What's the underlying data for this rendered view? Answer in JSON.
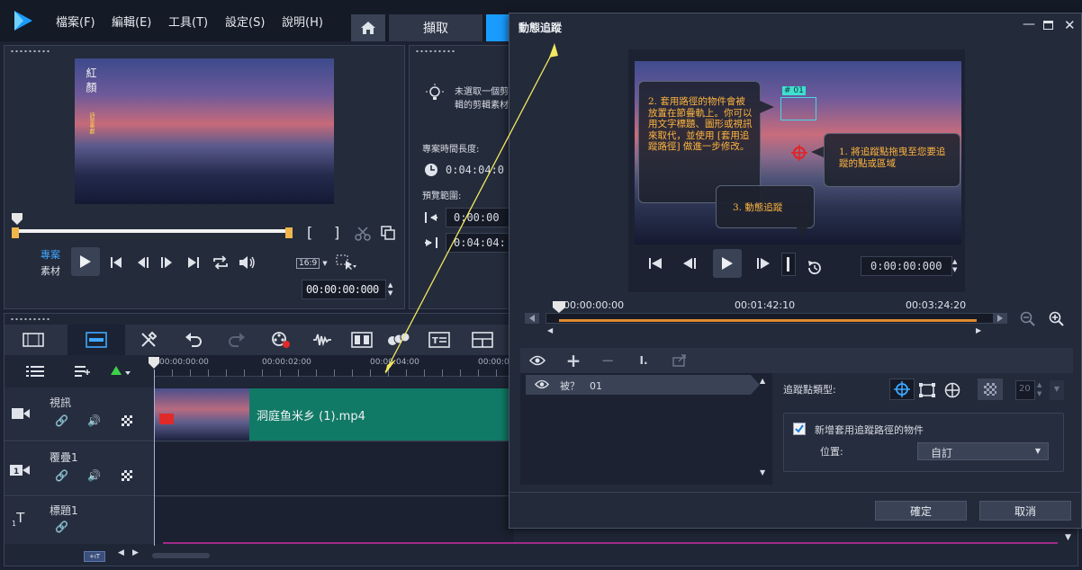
{
  "app": {
    "menu": [
      "檔案(F)",
      "編輯(E)",
      "工具(T)",
      "設定(S)",
      "說明(H)"
    ],
    "tab_capture": "擷取"
  },
  "player": {
    "project_label": "專案",
    "clip_label": "素材",
    "aspect": "16:9",
    "timecode": "00:00:00:000",
    "poem_title": "紅顏",
    "poem_sub": "詩意奉獻"
  },
  "options": {
    "hint_line1": "未選取一個剪",
    "hint_line2": "輯的剪輯素材",
    "duration_label": "專案時間長度:",
    "duration_value": "0:04:04:0",
    "preview_label": "預覽範圍:",
    "preview_start": "0:00:00",
    "preview_end": "0:04:04:"
  },
  "timeline": {
    "ruler": [
      "00:00:00:00",
      "00:00:02:00",
      "00:00:04:00",
      "00:00:06"
    ],
    "tracks": [
      {
        "name": "視訊"
      },
      {
        "name": "覆疊1"
      },
      {
        "name": "標題1"
      }
    ],
    "clip_name": "洞庭鱼米乡 (1).mp4"
  },
  "dialog": {
    "title": "動態追蹤",
    "ruler": [
      "00:00:00:00",
      "00:01:42:10",
      "00:03:24:20"
    ],
    "timecode": "0:00:00:000",
    "callout1": "1. 將追蹤點拖曳至您要追蹤的點或區域",
    "callout2": "2. 套用路徑的物件會被放置在節疊軌上。你可以用文字標題、圖形或視訊來取代，並使用 [套用追蹤路徑] 做進一步修改。",
    "callout3": "3. 動態追蹤",
    "track_box_label": "# 01",
    "tracker_item": "被？　01",
    "point_type_label": "追蹤點類型:",
    "size_value": "20",
    "checkbox_label": "新增套用追蹤路徑的物件",
    "position_label": "位置:",
    "position_value": "自訂",
    "ok": "確定",
    "cancel": "取消"
  }
}
